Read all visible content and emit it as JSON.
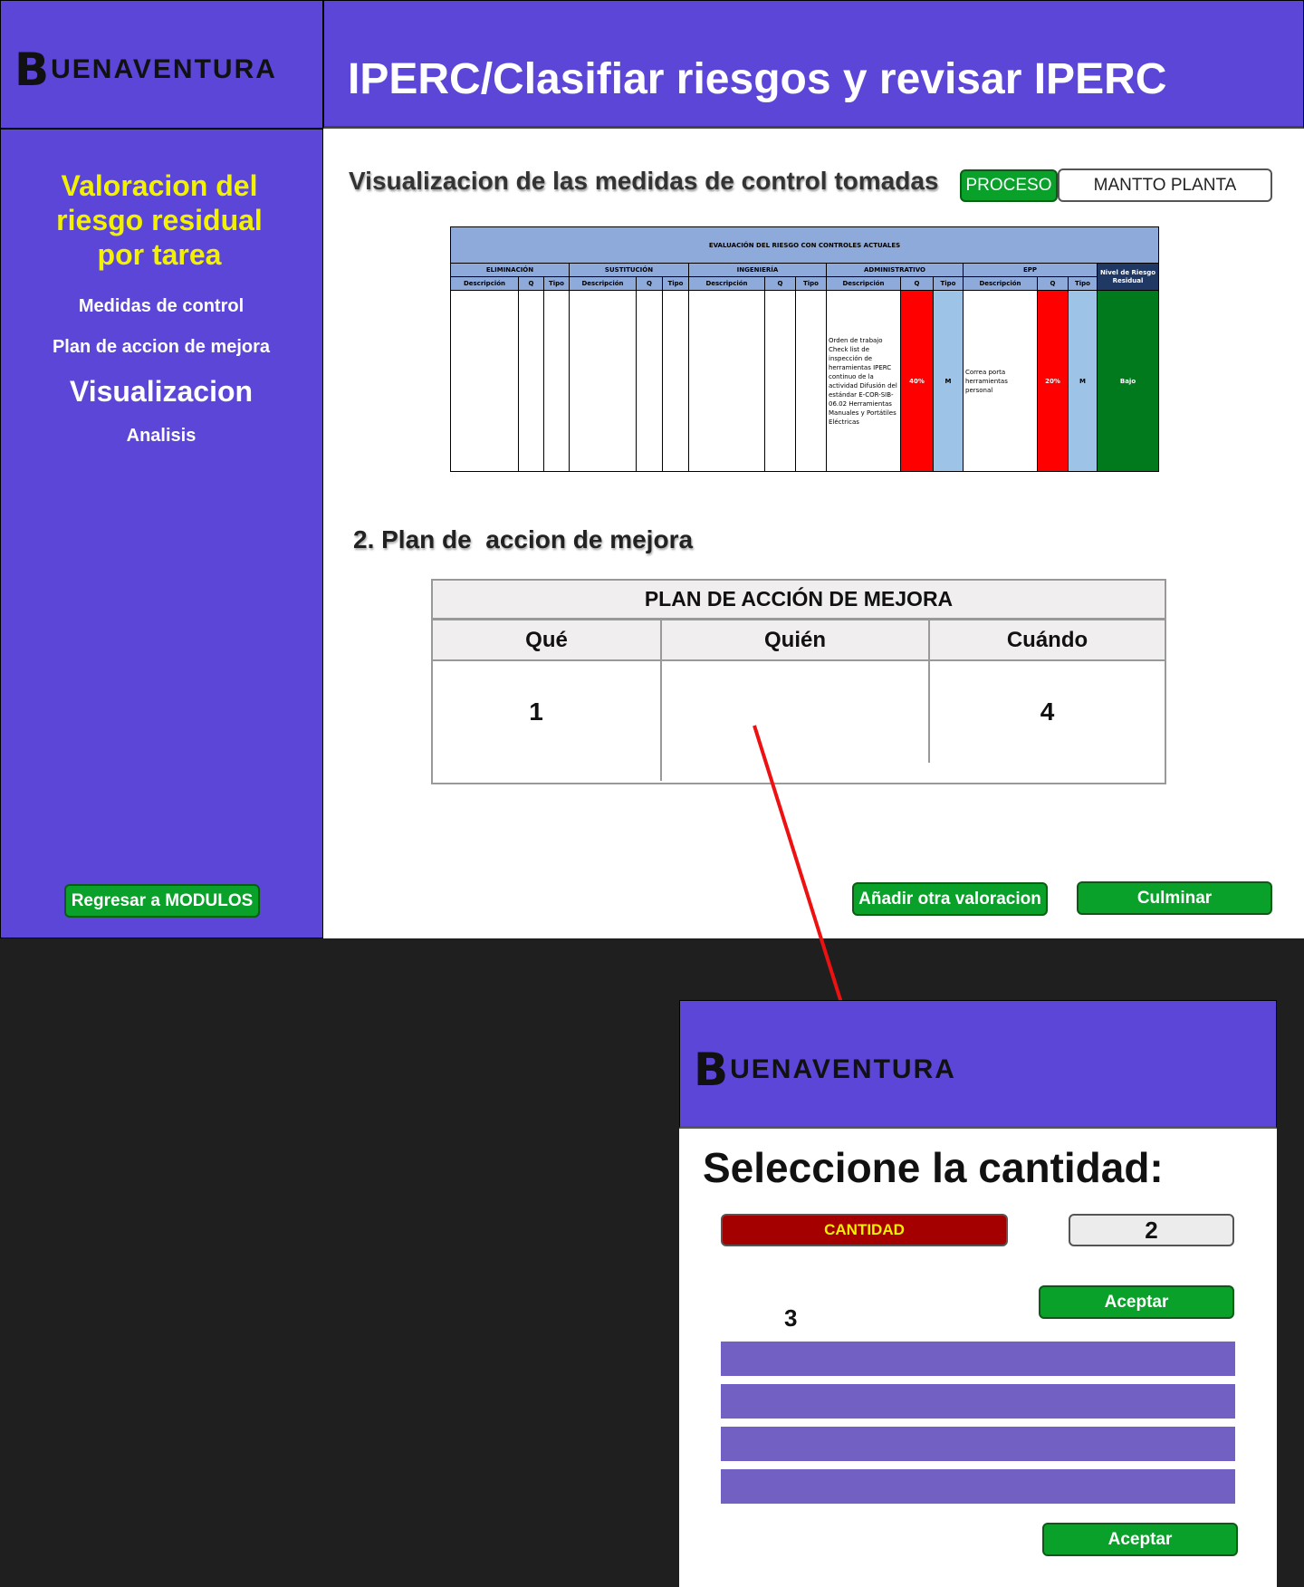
{
  "header": {
    "logo_initial": "B",
    "logo_rest": "UENAVENTURA",
    "title": "IPERC/Clasifiar riesgos y revisar IPERC"
  },
  "sidebar": {
    "heading": "Valoracion del riesgo residual por tarea",
    "items": [
      {
        "label": "Medidas de control"
      },
      {
        "label": "Plan de accion de mejora"
      },
      {
        "label": "Visualizacion"
      },
      {
        "label": "Analisis"
      }
    ],
    "back_button": "Regresar a MODULOS"
  },
  "main": {
    "section_title": "Visualizacion de las medidas de control tomadas",
    "proceso_label": "PROCESO",
    "proceso_value": "MANTTO PLANTA",
    "evaluation_table": {
      "title": "EVALUACIÓN DEL RIESGO CON CONTROLES ACTUALES",
      "groups": [
        "ELIMINACIÓN",
        "SUSTITUCIÓN",
        "INGENIERÍA",
        "ADMINISTRATIVO",
        "EPP"
      ],
      "residual_header": "Nivel de Riesgo Residual",
      "col_desc": "Descripción",
      "col_q": "Q",
      "col_tipo": "Tipo",
      "admin_description": "Orden de trabajo Check list de inspección de herramientas IPERC continuo de la actividad Difusión del estándar E-COR-SIB-06.02 Herramientas Manuales y Portátiles Eléctricas",
      "admin_q": "40%",
      "admin_tipo": "M",
      "epp_description": "Correa porta herramientas personal",
      "epp_q": "20%",
      "epp_tipo": "M",
      "residual_value": "Bajo"
    },
    "plan_section_title": "2. Plan de  accion de mejora",
    "plan_table": {
      "title": "PLAN DE ACCIÓN DE MEJORA",
      "headers": [
        "Qué",
        "Quién",
        "Cuándo"
      ],
      "cells": [
        "1",
        "",
        "4"
      ]
    },
    "add_button": "Añadir otra valoracion",
    "finish_button": "Culminar"
  },
  "popup": {
    "logo_initial": "B",
    "logo_rest": "UENAVENTURA",
    "heading": "Seleccione la cantidad:",
    "cantidad_label": "CANTIDAD",
    "cantidad_value": "2",
    "accept_label": "Aceptar",
    "list_marker": "3",
    "accept_bottom_label": "Aceptar"
  },
  "colors": {
    "primary_purple": "#5c46d8",
    "accent_yellow": "#f2f200",
    "button_green": "#0aa12a",
    "cantidad_red": "#a50000",
    "list_item_purple": "#7261c2",
    "risk_red": "#ff0000",
    "tipo_blue": "#9dc3e6",
    "residual_green": "#007a1c"
  }
}
